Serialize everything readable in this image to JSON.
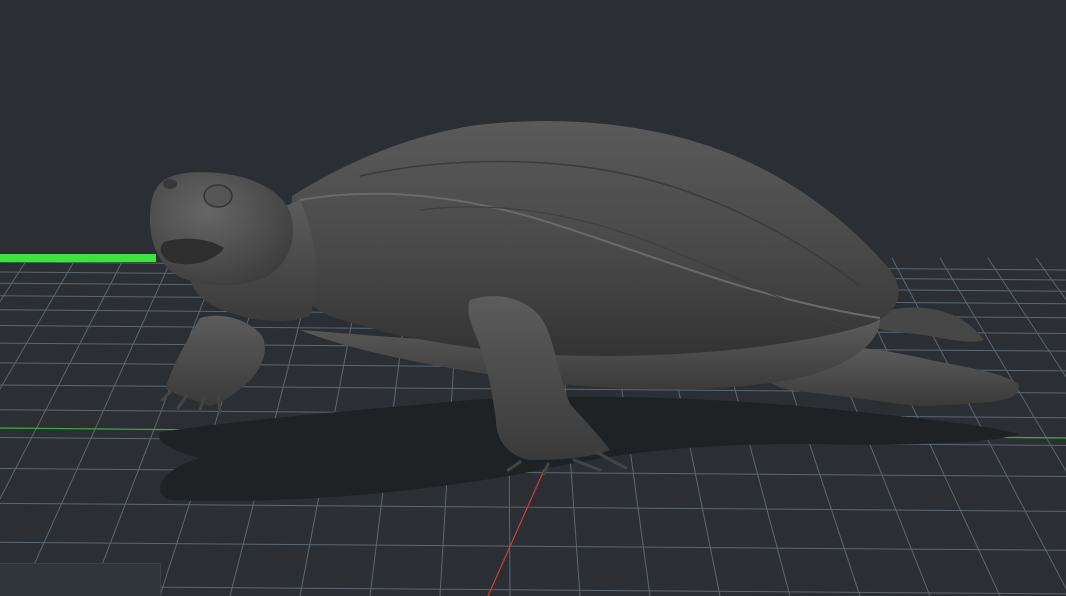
{
  "viewport": {
    "background_color": "#2b2f33",
    "grid_color": "#5c6670",
    "x_axis_color": "#d23a3a",
    "y_axis_color": "#3fae3f",
    "selection_highlight_color": "#39e639",
    "model_color": "#4d4d4d",
    "model_shadow_color": "#1f2225"
  },
  "model": {
    "icon": "turtle-3d-model"
  }
}
